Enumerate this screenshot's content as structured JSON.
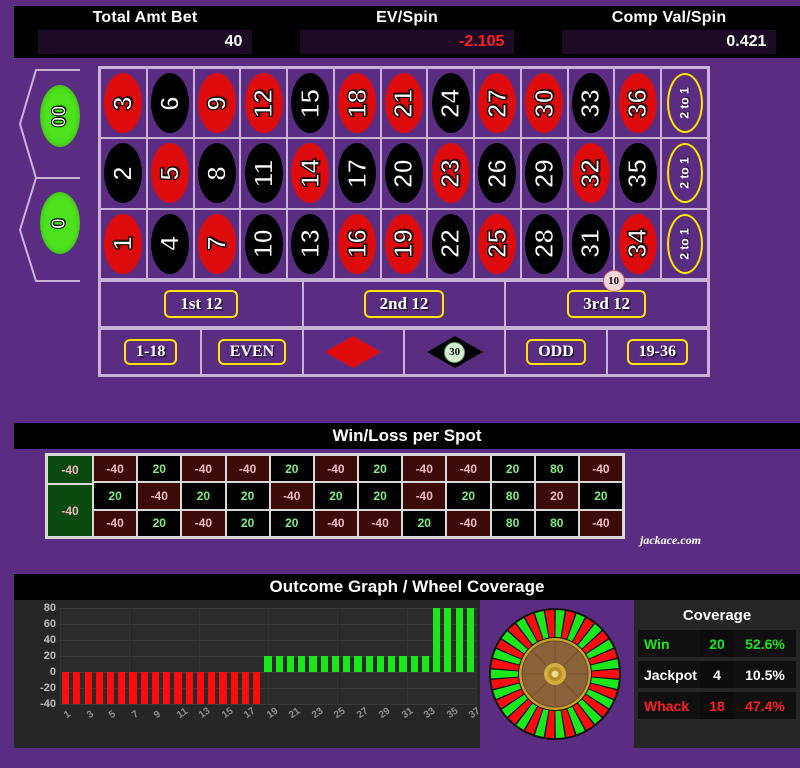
{
  "header": {
    "cells": [
      {
        "label": "Total Amt Bet",
        "value": "40",
        "negative": false
      },
      {
        "label": "EV/Spin",
        "value": "-2.105",
        "negative": true
      },
      {
        "label": "Comp Val/Spin",
        "value": "0.421",
        "negative": false
      }
    ]
  },
  "table": {
    "zeros": [
      {
        "label": "00"
      },
      {
        "label": "0"
      }
    ],
    "rows": [
      [
        {
          "n": "3",
          "c": "red"
        },
        {
          "n": "6",
          "c": "black"
        },
        {
          "n": "9",
          "c": "red"
        },
        {
          "n": "12",
          "c": "red"
        },
        {
          "n": "15",
          "c": "black"
        },
        {
          "n": "18",
          "c": "red"
        },
        {
          "n": "21",
          "c": "red"
        },
        {
          "n": "24",
          "c": "black"
        },
        {
          "n": "27",
          "c": "red"
        },
        {
          "n": "30",
          "c": "red"
        },
        {
          "n": "33",
          "c": "black"
        },
        {
          "n": "36",
          "c": "red"
        }
      ],
      [
        {
          "n": "2",
          "c": "black"
        },
        {
          "n": "5",
          "c": "red"
        },
        {
          "n": "8",
          "c": "black"
        },
        {
          "n": "11",
          "c": "black"
        },
        {
          "n": "14",
          "c": "red"
        },
        {
          "n": "17",
          "c": "black"
        },
        {
          "n": "20",
          "c": "black"
        },
        {
          "n": "23",
          "c": "red"
        },
        {
          "n": "26",
          "c": "black"
        },
        {
          "n": "29",
          "c": "black"
        },
        {
          "n": "32",
          "c": "red"
        },
        {
          "n": "35",
          "c": "black"
        }
      ],
      [
        {
          "n": "1",
          "c": "red"
        },
        {
          "n": "4",
          "c": "black"
        },
        {
          "n": "7",
          "c": "red"
        },
        {
          "n": "10",
          "c": "black"
        },
        {
          "n": "13",
          "c": "black"
        },
        {
          "n": "16",
          "c": "red"
        },
        {
          "n": "19",
          "c": "red"
        },
        {
          "n": "22",
          "c": "black"
        },
        {
          "n": "25",
          "c": "red"
        },
        {
          "n": "28",
          "c": "black"
        },
        {
          "n": "31",
          "c": "black"
        },
        {
          "n": "34",
          "c": "red"
        }
      ]
    ],
    "column_bets": [
      "2 to 1",
      "2 to 1",
      "2 to 1"
    ],
    "dozens": [
      "1st 12",
      "2nd 12",
      "3rd 12"
    ],
    "outside": [
      "1-18",
      "EVEN",
      "RED",
      "BLACK",
      "ODD",
      "19-36"
    ],
    "chips": [
      {
        "name": "chip-3rd-12",
        "value": "10"
      },
      {
        "name": "chip-black",
        "value": "30"
      }
    ]
  },
  "winloss": {
    "title": "Win/Loss per Spot",
    "zeros": [
      "-40",
      "-40"
    ],
    "rows": [
      [
        "-40",
        "20",
        "-40",
        "-40",
        "20",
        "-40",
        "20",
        "-40",
        "-40",
        "20",
        "80",
        "-40"
      ],
      [
        "20",
        "-40",
        "20",
        "20",
        "-40",
        "20",
        "20",
        "-40",
        "20",
        "80",
        "20",
        "20"
      ],
      [
        "-40",
        "20",
        "-40",
        "20",
        "20",
        "-40",
        "-40",
        "20",
        "-40",
        "80",
        "80",
        "-40"
      ]
    ],
    "brand": "jackace.com"
  },
  "outcome": {
    "title": "Outcome Graph / Wheel Coverage"
  },
  "coverage": {
    "title": "Coverage",
    "rows": [
      {
        "label": "Win",
        "count": "20",
        "pct": "52.6%",
        "color": "#1ae81a"
      },
      {
        "label": "Jackpot",
        "count": "4",
        "pct": "10.5%",
        "color": "#ffffff"
      },
      {
        "label": "Whack",
        "count": "18",
        "pct": "47.4%",
        "color": "#ff1e1e"
      }
    ]
  },
  "chart_data": {
    "type": "bar",
    "title": "Outcome Graph / Wheel Coverage",
    "xlabel": "",
    "ylabel": "",
    "ylim": [
      -40,
      80
    ],
    "yticks": [
      80,
      60,
      40,
      20,
      0,
      -20,
      -40
    ],
    "grid": true,
    "categories": [
      "1",
      "2",
      "3",
      "4",
      "5",
      "6",
      "7",
      "8",
      "9",
      "10",
      "11",
      "12",
      "13",
      "14",
      "15",
      "16",
      "17",
      "18",
      "19",
      "20",
      "21",
      "22",
      "23",
      "24",
      "25",
      "26",
      "27",
      "28",
      "29",
      "30",
      "31",
      "32",
      "33",
      "34",
      "35",
      "36",
      "37"
    ],
    "tick_labels": [
      "1",
      "3",
      "5",
      "7",
      "9",
      "11",
      "13",
      "15",
      "17",
      "19",
      "21",
      "23",
      "25",
      "27",
      "29",
      "31",
      "33",
      "35",
      "37"
    ],
    "values": [
      -40,
      -40,
      -40,
      -40,
      -40,
      -40,
      -40,
      -40,
      -40,
      -40,
      -40,
      -40,
      -40,
      -40,
      -40,
      -40,
      -40,
      -40,
      20,
      20,
      20,
      20,
      20,
      20,
      20,
      20,
      20,
      20,
      20,
      20,
      20,
      20,
      20,
      80,
      80,
      80,
      80
    ],
    "positive_color": "#1ae81a",
    "negative_color": "#fb0d0d"
  },
  "colors": {
    "felt": "#5b2d82",
    "red": "#dd0b0b",
    "black": "#000000",
    "green": "#4de21e",
    "yellow": "#ffe600"
  }
}
